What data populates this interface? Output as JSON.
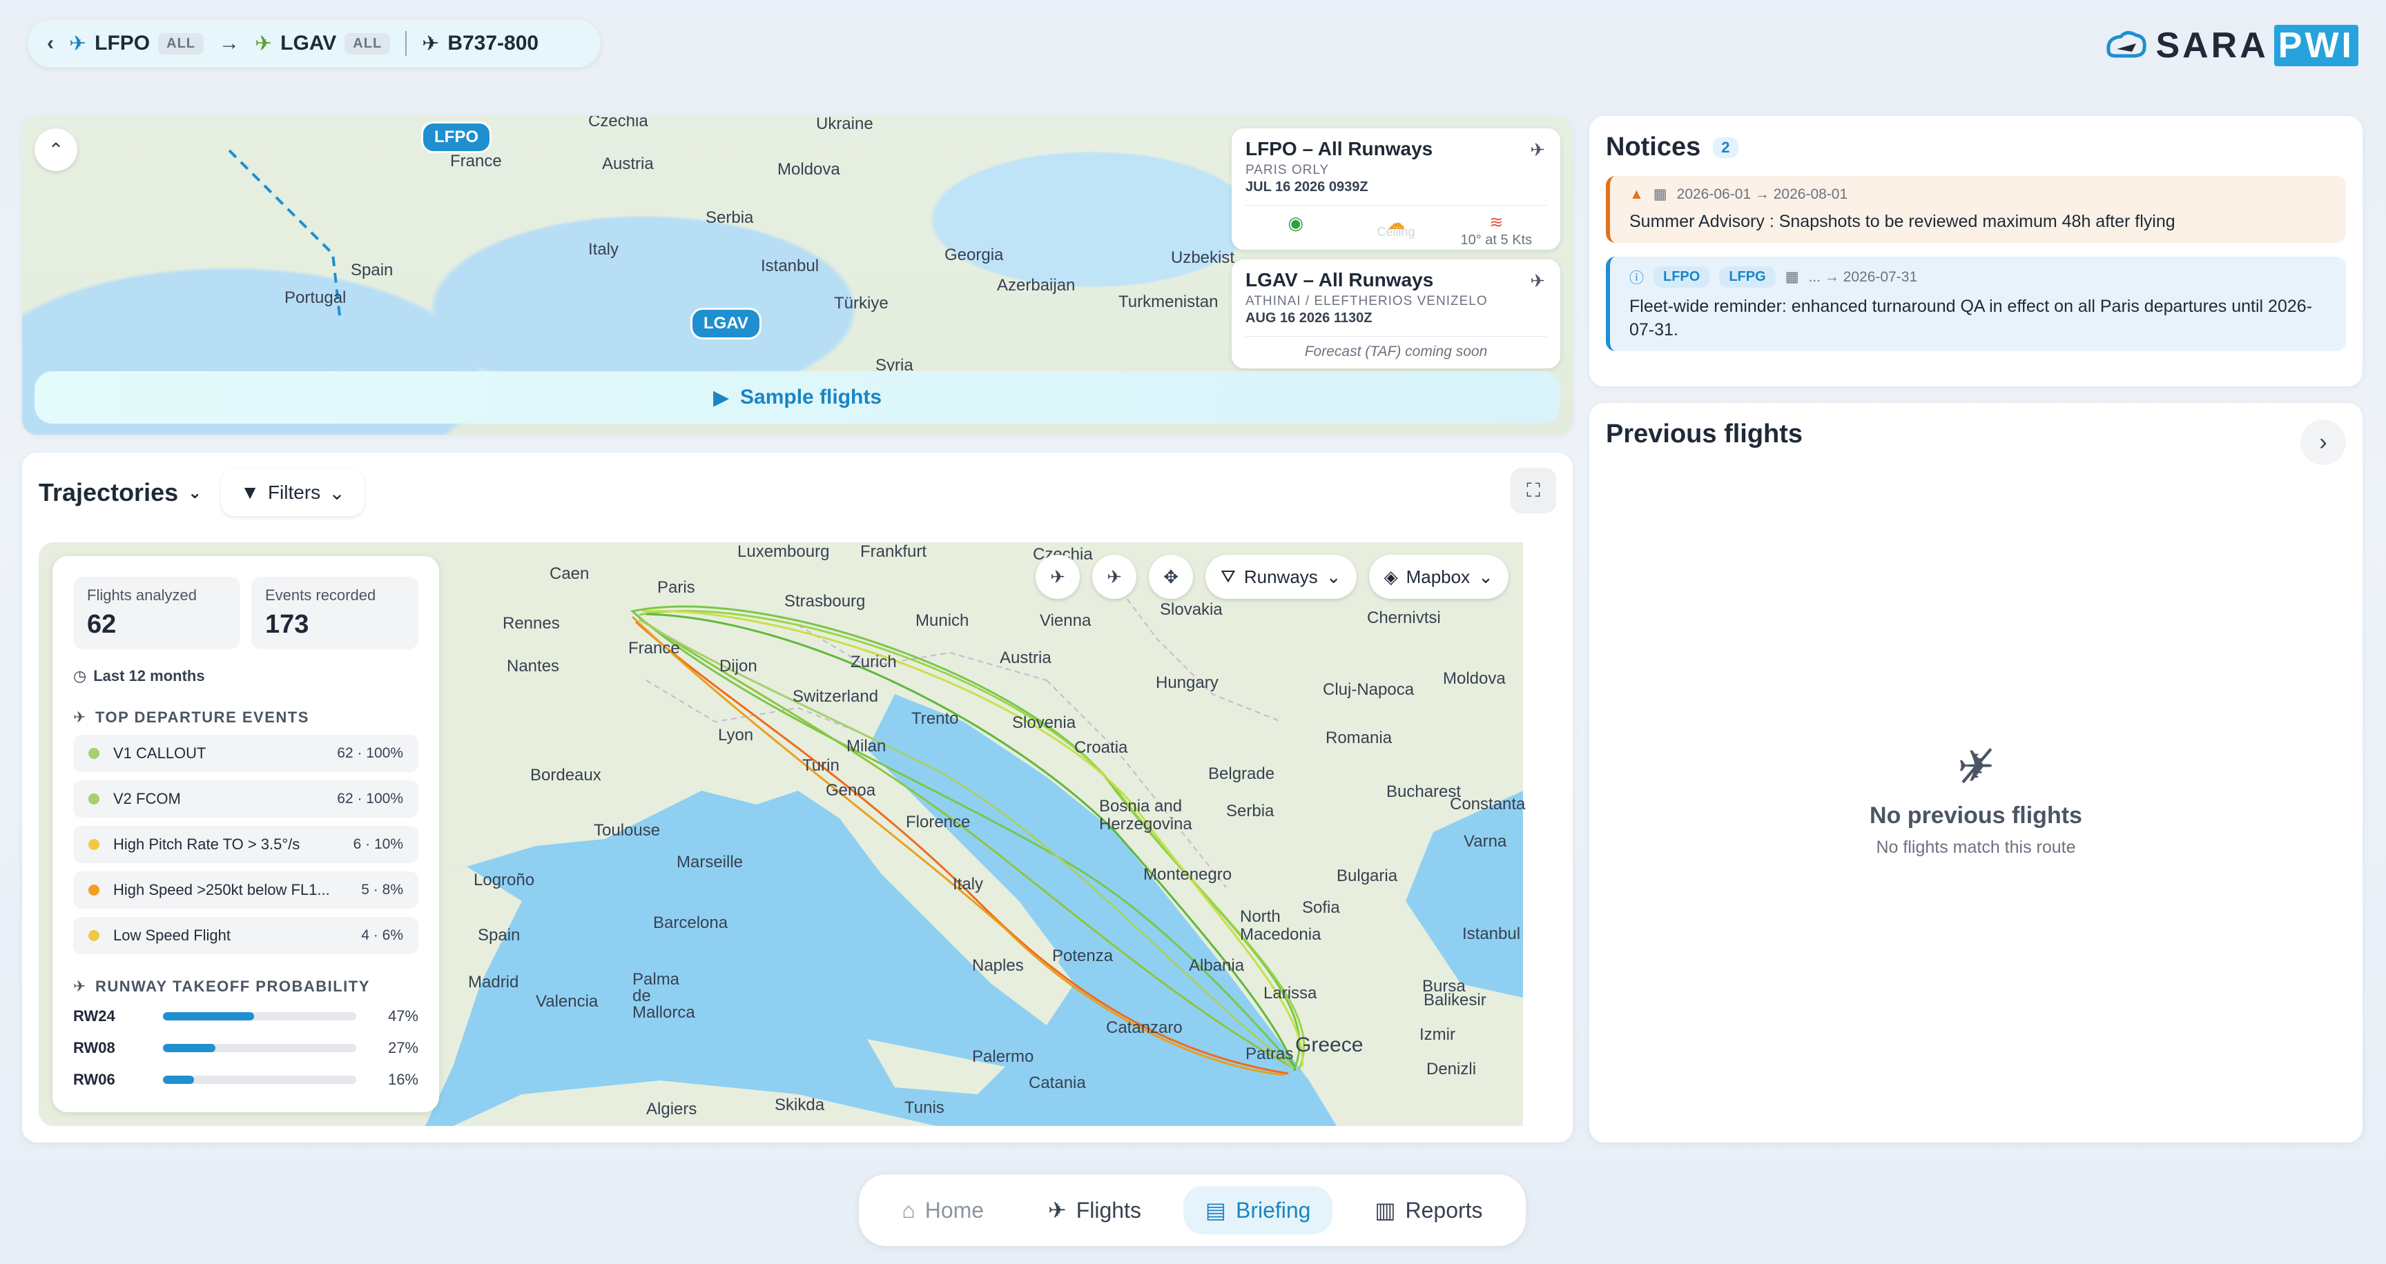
{
  "route": {
    "origin": "LFPO",
    "origin_tag": "ALL",
    "destination": "LGAV",
    "destination_tag": "ALL",
    "aircraft": "B737-800"
  },
  "logo": {
    "left": "SARA",
    "right": "PWI"
  },
  "top_map": {
    "origin_label": "LFPO",
    "destination_label": "LGAV",
    "places": [
      "Czechia",
      "Ukraine",
      "France",
      "Austria",
      "Moldova",
      "Spain",
      "Italy",
      "Serbia",
      "Portugal",
      "Istanbul",
      "Georgia",
      "Azerbaijan",
      "Türkiye",
      "Turkmenistan",
      "Uzbekist",
      "Syria"
    ],
    "sample_label": "Sample flights",
    "departure_card": {
      "title": "LFPO – All Runways",
      "subtitle": "PARIS ORLY",
      "date": "JUL 16 2026 0939Z",
      "wind": "10° at 5 Kts",
      "ceiling": "Ceiling"
    },
    "arrival_card": {
      "title": "LGAV – All Runways",
      "subtitle": "ATHINAI / ELEFTHERIOS VENIZELO",
      "date": "AUG 16 2026 1130Z",
      "forecast": "Forecast (TAF) coming soon"
    }
  },
  "notices": {
    "title": "Notices",
    "count": "2",
    "items": [
      {
        "kind": "warning",
        "dates": "2026-06-01 → 2026-08-01",
        "text": "Summer Advisory : Snapshots to be reviewed maximum 48h after flying"
      },
      {
        "kind": "info",
        "chips": [
          "LFPO",
          "LFPG"
        ],
        "dates": "... → 2026-07-31",
        "text": "Fleet-wide reminder: enhanced turnaround QA in effect on all Paris departures until 2026-07-31."
      }
    ]
  },
  "previous_flights": {
    "title": "Previous flights",
    "empty_title": "No previous flights",
    "empty_text": "No flights match this route"
  },
  "trajectories": {
    "title": "Trajectories",
    "filters_label": "Filters",
    "runways_label": "Runways",
    "mapbox_label": "Mapbox",
    "map_places": [
      "Luxembourg",
      "Frankfurt",
      "Czechia",
      "Caen",
      "Paris",
      "Strasbourg",
      "Munich",
      "Vienna",
      "Slovakia",
      "Rennes",
      "France",
      "Zurich",
      "Austria",
      "Chernivtsi",
      "Nantes",
      "Dijon",
      "Switzerland",
      "Hungary",
      "Moldova",
      "Trento",
      "Slovenia",
      "Cluj-Napoca",
      "Lyon",
      "Milan",
      "Croatia",
      "Romania",
      "Bordeaux",
      "Turin",
      "Bosnia and Herzegovina",
      "Belgrade",
      "Genoa",
      "Serbia",
      "Bucharest",
      "Constanta",
      "Toulouse",
      "Florence",
      "Varna",
      "Marseille",
      "Montenegro",
      "Bulgaria",
      "Logroño",
      "Italy",
      "Sofia",
      "Barcelona",
      "North Macedonia",
      "Istanbul",
      "Spain",
      "Naples",
      "Potenza",
      "Albania",
      "Madrid",
      "Palma de Mallorca",
      "Larissa",
      "Bursa",
      "Valencia",
      "Balikesir",
      "Greece",
      "Izmir",
      "Catanzaro",
      "Patras",
      "Palermo",
      "Denizli",
      "Catania",
      "Skikda",
      "Tunis",
      "Algiers"
    ]
  },
  "stats": {
    "flights_label": "Flights analyzed",
    "flights_value": "62",
    "events_label": "Events recorded",
    "events_value": "173",
    "period": "Last 12 months",
    "departure_title": "TOP DEPARTURE EVENTS",
    "events": [
      {
        "name": "V1 CALLOUT",
        "count": "62 · 100%",
        "color": "#a6cf6e"
      },
      {
        "name": "V2 FCOM",
        "count": "62 · 100%",
        "color": "#a6cf6e"
      },
      {
        "name": "High Pitch Rate TO > 3.5°/s",
        "count": "6 · 10%",
        "color": "#f2c744"
      },
      {
        "name": "High Speed >250kt below FL1...",
        "count": "5 · 8%",
        "color": "#f0a020"
      },
      {
        "name": "Low Speed Flight",
        "count": "4 · 6%",
        "color": "#f2c744"
      }
    ],
    "runway_title": "RUNWAY TAKEOFF PROBABILITY",
    "runways": [
      {
        "name": "RW24",
        "pct": "47%",
        "fraction": 0.47
      },
      {
        "name": "RW08",
        "pct": "27%",
        "fraction": 0.27
      },
      {
        "name": "RW06",
        "pct": "16%",
        "fraction": 0.16
      }
    ]
  },
  "nav": {
    "items": [
      {
        "label": "Home",
        "icon": "home-icon"
      },
      {
        "label": "Flights",
        "icon": "plane-icon"
      },
      {
        "label": "Briefing",
        "icon": "document-icon"
      },
      {
        "label": "Reports",
        "icon": "chart-icon"
      }
    ],
    "active": "Briefing"
  },
  "colors": {
    "accent": "#1f8fd0",
    "warning": "#e0731f",
    "route_green": "#7ac64b",
    "route_orange": "#f06a1c"
  }
}
